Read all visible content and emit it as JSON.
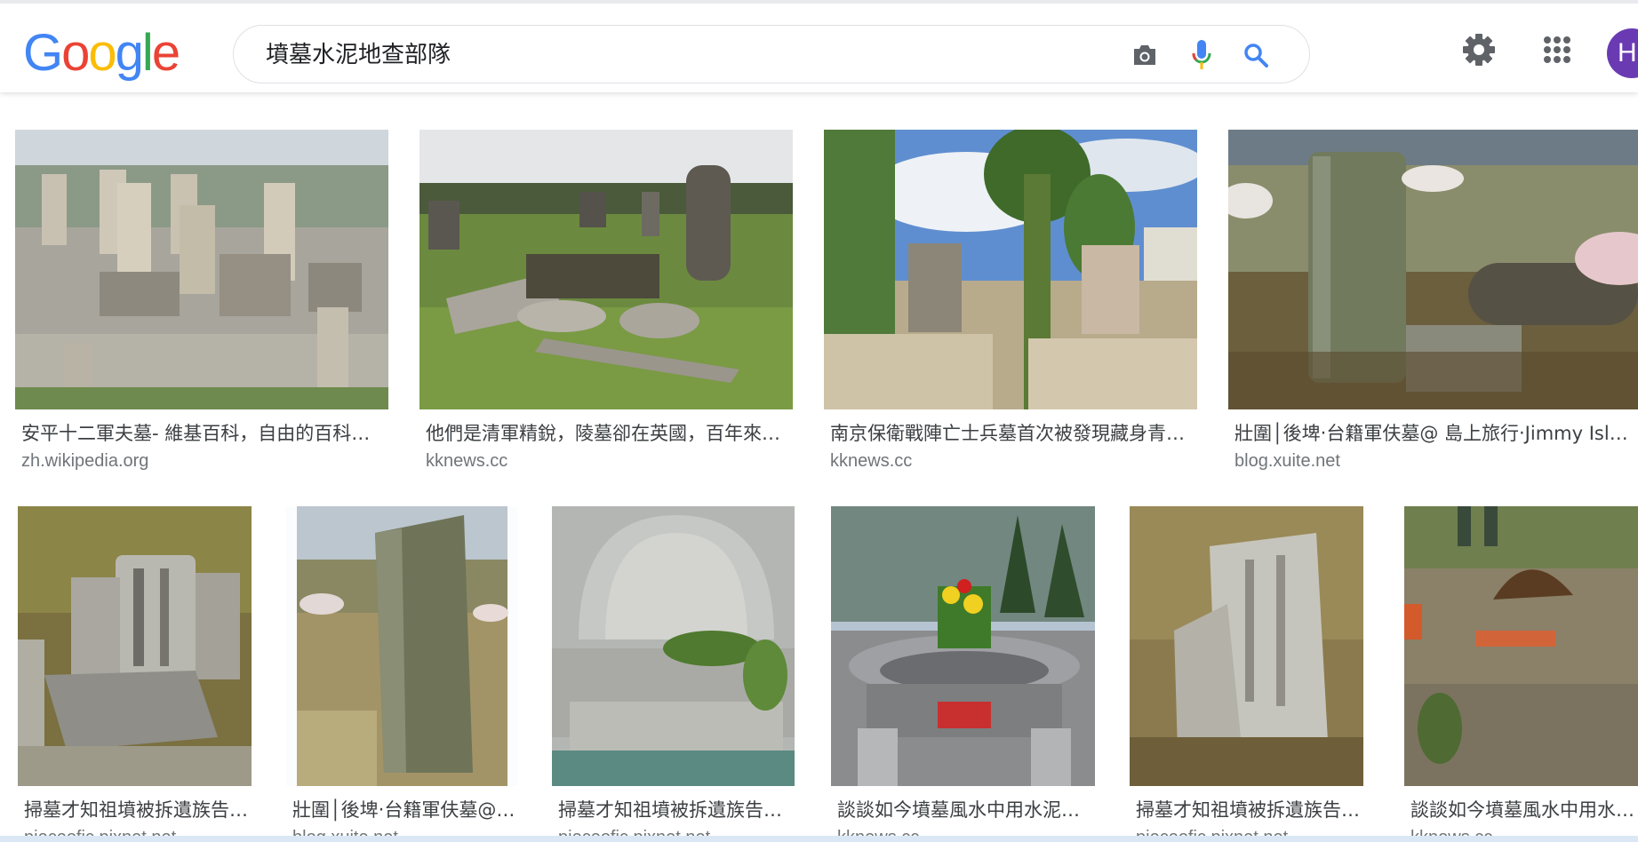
{
  "header": {
    "logo_letters": [
      {
        "char": "G",
        "color": "#4285F4"
      },
      {
        "char": "o",
        "color": "#EA4335"
      },
      {
        "char": "o",
        "color": "#FBBC05"
      },
      {
        "char": "g",
        "color": "#4285F4"
      },
      {
        "char": "l",
        "color": "#34A853"
      },
      {
        "char": "e",
        "color": "#EA4335"
      }
    ],
    "search_query": "墳墓水泥地查部隊",
    "icons": [
      "camera-icon",
      "microphone-icon",
      "search-icon",
      "gear-icon",
      "apps-grid-icon"
    ],
    "avatar_initial": "H"
  },
  "results": {
    "row1": [
      {
        "title": "安平十二軍夫墓- 維基百科，自由的百科全書",
        "domain": "zh.wikipedia.org"
      },
      {
        "title": "他們是清軍精銳，陵墓卻在英國，百年來無人問津",
        "domain": "kknews.cc"
      },
      {
        "title": "南京保衛戰陣亡士兵墓首次被發現藏身青龍山",
        "domain": "kknews.cc"
      },
      {
        "title": "壯圍│後埤‧台籍軍伕墓@ 島上旅行‧Jimmy Island",
        "domain": "blog.xuite.net"
      }
    ],
    "row2": [
      {
        "title": "掃墓才知祖墳被拆遺族告鎮公所",
        "domain": "pieceofic.pixnet.net"
      },
      {
        "title": "壯圍│後埤‧台籍軍伕墓@ 島上旅行",
        "domain": "blog.xuite.net"
      },
      {
        "title": "掃墓才知祖墳被拆遺族告鎮公所",
        "domain": "pieceofic.pixnet.net"
      },
      {
        "title": "談談如今墳墓風水中用水泥的問題",
        "domain": "kknews.cc"
      },
      {
        "title": "掃墓才知祖墳被拆遺族告鎮公所",
        "domain": "pieceofic.pixnet.net"
      },
      {
        "title": "談談如今墳墓風水中用水泥的問題",
        "domain": "kknews.cc"
      }
    ]
  },
  "colors": {
    "accent_blue": "#4285F4",
    "avatar_purple": "#6a3ab2",
    "title_text": "#3c4043",
    "domain_text": "#70757a"
  }
}
